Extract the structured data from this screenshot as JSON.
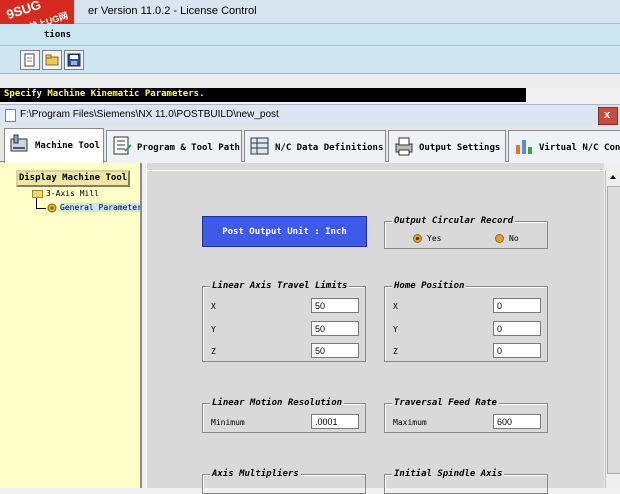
{
  "app": {
    "title": "er Version 11.0.2 - License Control",
    "watermark_line1": "9SUG",
    "watermark_line2": "学UG就上UG网"
  },
  "menubar": {
    "visible_text": "tions"
  },
  "toolbar": {
    "buttons": [
      "new-file-icon",
      "open-folder-icon",
      "save-icon"
    ]
  },
  "status": {
    "message": "Specify Machine Kinematic Parameters."
  },
  "inner_window": {
    "title": "F:\\Program Files\\Siemens\\NX 11.0\\POSTBUILD\\new_post",
    "close_glyph": "x"
  },
  "tabs": [
    {
      "label": "Machine Tool",
      "icon": "machine-tool-icon",
      "active": true
    },
    {
      "label": "Program & Tool Path",
      "icon": "program-icon",
      "active": false
    },
    {
      "label": "N/C Data Definitions",
      "icon": "nc-data-icon",
      "active": false
    },
    {
      "label": "Output Settings",
      "icon": "printer-icon",
      "active": false
    },
    {
      "label": "Virtual N/C Con",
      "icon": "virtual-nc-icon",
      "active": false
    }
  ],
  "tree": {
    "display_button": "Display Machine Tool",
    "root": "3-Axis Mill",
    "child": "General Parameters"
  },
  "params": {
    "unit_button": "Post Output Unit : Inch",
    "circular_record": {
      "title": "Output Circular Record",
      "yes": "Yes",
      "no": "No",
      "selected": "Yes"
    },
    "linear_limits": {
      "title": "Linear Axis Travel Limits",
      "rows": [
        {
          "label": "X",
          "value": "50"
        },
        {
          "label": "Y",
          "value": "50"
        },
        {
          "label": "Z",
          "value": "50"
        }
      ]
    },
    "home_position": {
      "title": "Home Position",
      "rows": [
        {
          "label": "X",
          "value": "0"
        },
        {
          "label": "Y",
          "value": "0"
        },
        {
          "label": "Z",
          "value": "0"
        }
      ]
    },
    "linear_resolution": {
      "title": "Linear Motion Resolution",
      "label": "Minimum",
      "value": ".0001"
    },
    "traversal_feed": {
      "title": "Traversal Feed Rate",
      "label": "Maximum",
      "value": "600"
    },
    "axis_multipliers": {
      "title": "Axis Multipliers"
    },
    "initial_spindle": {
      "title": "Initial Spindle Axis"
    }
  },
  "colors": {
    "unit_button_bg": "#3d5ae8",
    "status_bg": "#000000",
    "status_fg": "#ffff66",
    "tree_bg": "#ffffc8"
  }
}
